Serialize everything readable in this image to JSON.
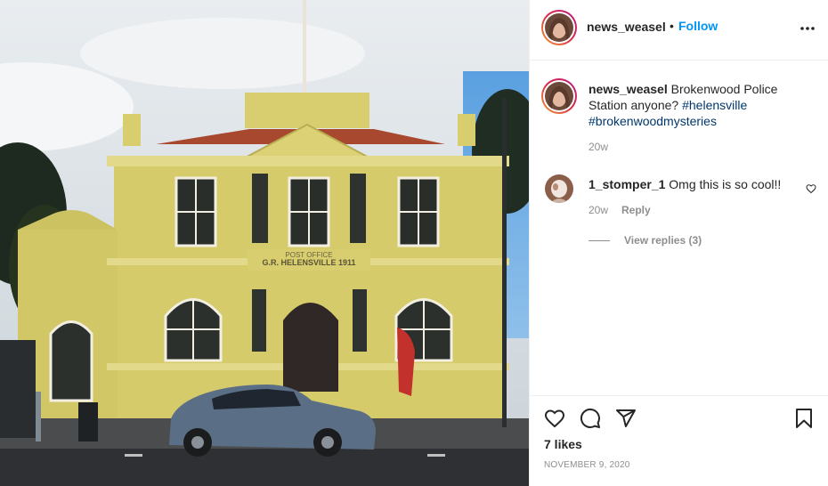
{
  "post": {
    "username": "news_weasel",
    "follow_label": "Follow",
    "separator": "•",
    "photo_sign": {
      "line1": "POST OFFICE",
      "line2": "G.R. HELENSVILLE 1911"
    },
    "caption": {
      "username": "news_weasel",
      "text": "Brokenwood Police Station anyone? ",
      "hashtags": [
        "#helensville",
        "#brokenwoodmysteries"
      ],
      "time": "20w"
    },
    "comments": [
      {
        "username": "1_stomper_1",
        "text": "Omg this is so cool!!",
        "time": "20w",
        "reply_label": "Reply",
        "view_replies_label": "View replies (3)"
      }
    ],
    "likes": "7 likes",
    "date": "NOVEMBER 9, 2020"
  },
  "icons": {
    "more": "more-options-icon",
    "like": "heart-icon",
    "comment": "comment-icon",
    "share": "share-icon",
    "save": "bookmark-icon",
    "comment_like": "heart-small-icon"
  },
  "colors": {
    "link": "#0095f6",
    "hashtag": "#00376b",
    "muted": "#8e8e8e",
    "building": "#d9cf6e"
  }
}
